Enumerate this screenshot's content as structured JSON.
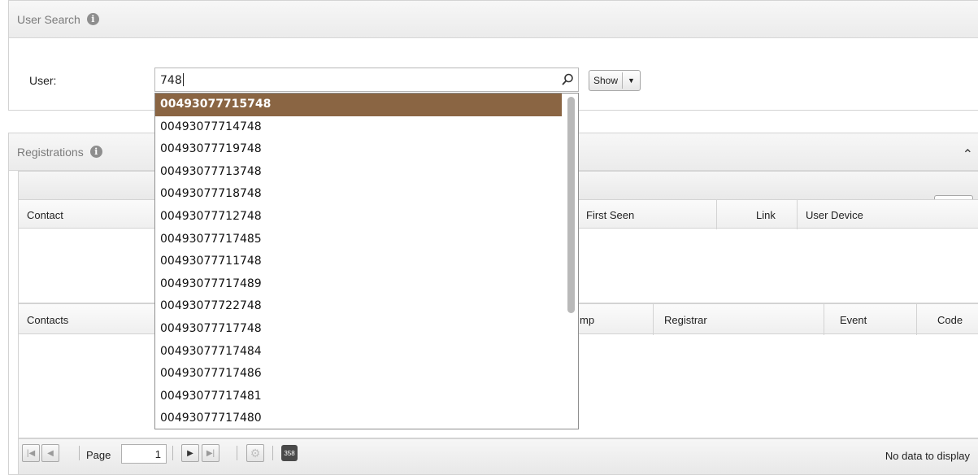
{
  "user_search": {
    "title": "User Search",
    "user_label": "User:",
    "input_value": "748",
    "show_label": "Show"
  },
  "registrations": {
    "title": "Registrations",
    "grid1_columns": [
      "Contact",
      "First Seen",
      "Link",
      "User Device"
    ],
    "grid2_columns": [
      "Contacts",
      "mp",
      "Registrar",
      "Event",
      "Code"
    ]
  },
  "pager": {
    "page_label": "Page",
    "page_value": "1",
    "export_label": "358",
    "status": "No data to display"
  },
  "autocomplete": {
    "selected_index": 0,
    "items": [
      "00493077715748",
      "00493077714748",
      "00493077719748",
      "00493077713748",
      "00493077718748",
      "00493077712748",
      "00493077717485",
      "00493077711748",
      "00493077717489",
      "00493077722748",
      "00493077717748",
      "00493077717484",
      "00493077717486",
      "00493077717481",
      "00493077717480"
    ]
  },
  "colors": {
    "selected_bg": "#8a6543",
    "panel_header": "#ebebeb"
  },
  "icons": [
    "info-icon",
    "search-icon",
    "chevron-down-icon",
    "collapse-up-icon",
    "gear-icon",
    "first-page-icon",
    "prev-page-icon",
    "next-page-icon",
    "last-page-icon",
    "refresh-icon",
    "export-icon"
  ]
}
